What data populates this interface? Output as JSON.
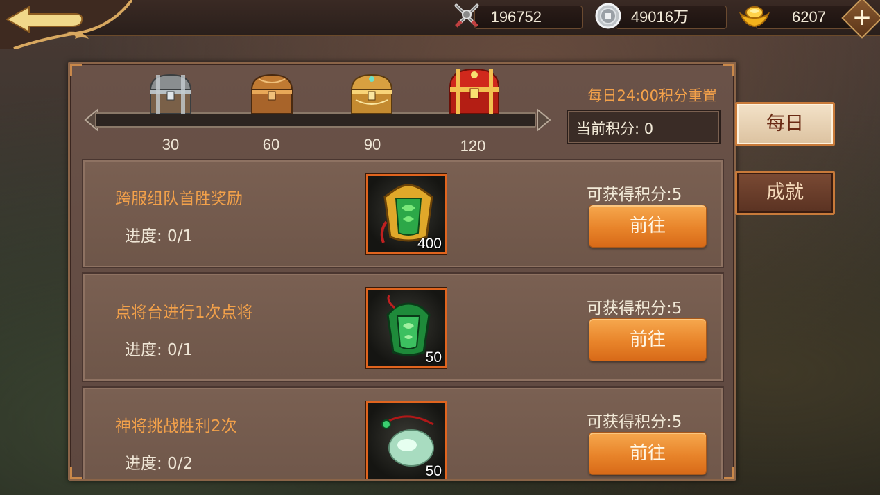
{
  "currencies": [
    {
      "icon": "crossed-swords-icon",
      "value": "196752"
    },
    {
      "icon": "silver-coin-icon",
      "value": "49016万"
    },
    {
      "icon": "gold-ingot-icon",
      "value": "6207"
    }
  ],
  "progress": {
    "chests": [
      {
        "icon": "silver-chest-icon",
        "threshold": "30"
      },
      {
        "icon": "bronze-chest-icon",
        "threshold": "60"
      },
      {
        "icon": "gold-chest-icon",
        "threshold": "90"
      },
      {
        "icon": "red-chest-icon",
        "threshold": "120"
      }
    ],
    "current_fill": 0
  },
  "reset_note": "每日24:00积分重置",
  "current_score": "当前积分:  0",
  "tabs": [
    {
      "label": "每日",
      "active": true
    },
    {
      "label": "成就",
      "active": false
    }
  ],
  "tasks": [
    {
      "title": "跨服组队首胜奖励",
      "progress": "进度:  0/1",
      "reward_icon": "jade-token-gold-icon",
      "reward_count": "400",
      "points": "可获得积分:5",
      "button": "前往"
    },
    {
      "title": "点将台进行1次点将",
      "progress": "进度:  0/1",
      "reward_icon": "jade-token-green-icon",
      "reward_count": "50",
      "points": "可获得积分:5",
      "button": "前往"
    },
    {
      "title": "神将挑战胜利2次",
      "progress": "进度:  0/2",
      "reward_icon": "jade-pendant-icon",
      "reward_count": "50",
      "points": "可获得积分:5",
      "button": "前往"
    }
  ],
  "colors": {
    "accent_orange": "#f3a14a",
    "button_orange": "#e8842a",
    "reward_border": "#e0641e"
  }
}
